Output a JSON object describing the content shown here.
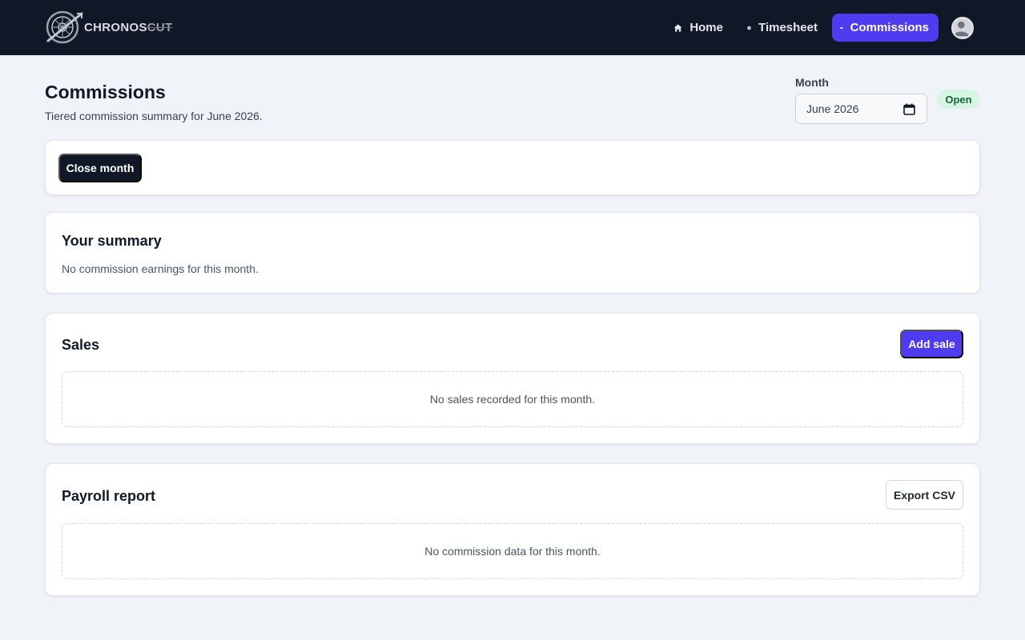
{
  "brand": {
    "name_main": "CHRONOS",
    "name_dim": "CUT"
  },
  "nav": {
    "items": [
      {
        "label": "Home",
        "icon": "home-icon"
      },
      {
        "label": "Timesheet",
        "icon": "clock-icon"
      },
      {
        "label": "Commissions",
        "icon": "money-icon",
        "active": true
      }
    ],
    "avatar_icon": "user-avatar-icon"
  },
  "header": {
    "title": "Commissions",
    "subtitle": "Tiered commission summary for June 2026."
  },
  "month_picker": {
    "label": "Month",
    "value": "June 2026",
    "icon": "calendar-icon"
  },
  "status_badge": "Open",
  "actions": {
    "close_month_label": "Close month"
  },
  "summary": {
    "title": "Your summary",
    "empty_text": "No commission earnings for this month."
  },
  "sales": {
    "title": "Sales",
    "add_label": "Add sale",
    "empty_text": "No sales recorded for this month."
  },
  "payroll": {
    "title": "Payroll report",
    "export_label": "Export CSV",
    "empty_text": "No commission data for this month."
  },
  "colors": {
    "topbar": "#101828",
    "accent": "#4f3bf0",
    "badge_bg": "#d6f5e3",
    "badge_text": "#166534"
  }
}
